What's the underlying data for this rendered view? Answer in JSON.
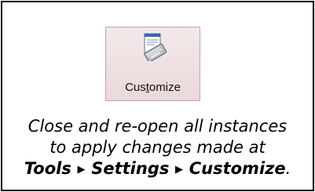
{
  "button": {
    "label": "Customize",
    "mnemonic_letter": "t",
    "icon": "keyboard-document-icon"
  },
  "message": {
    "line1": "Close and re-open all instances",
    "line2": "to apply changes made at",
    "path": [
      "Tools",
      "Settings",
      "Customize"
    ],
    "path_separator": "▶",
    "end_punct": "."
  },
  "colors": {
    "button_bg": "#efe2e4",
    "button_border": "#c9a2a7",
    "frame_border": "#000000"
  }
}
